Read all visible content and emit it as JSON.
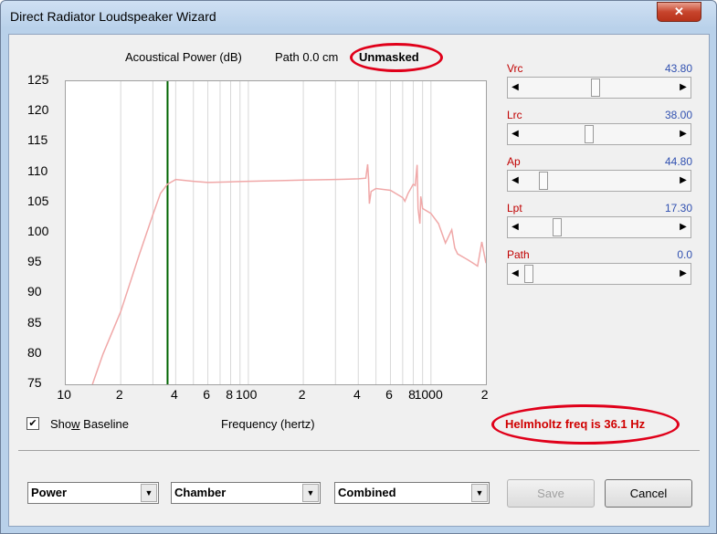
{
  "window": {
    "title": "Direct Radiator Loudspeaker Wizard",
    "close_glyph": "✕"
  },
  "plot_header": {
    "power": "Acoustical Power (dB)",
    "path": "Path 0.0 cm",
    "mask": "Unmasked"
  },
  "chart_data": {
    "type": "line",
    "xlabel": "Frequency (hertz)",
    "ylabel": "",
    "xscale": "log",
    "xlim": [
      10,
      2000
    ],
    "ylim": [
      75,
      125
    ],
    "y_ticks": [
      "125",
      "120",
      "115",
      "110",
      "105",
      "100",
      "95",
      "90",
      "85",
      "80",
      "75"
    ],
    "x_ticks": [
      "10",
      "2",
      "4",
      "6",
      "8",
      "100",
      "2",
      "4",
      "6",
      "8",
      "1000",
      "2"
    ],
    "marker_frequency": 36.1,
    "series": [
      {
        "color": "#f0a8a8",
        "x": [
          14,
          16,
          20,
          25,
          30,
          33,
          36,
          40,
          50,
          60,
          80,
          100,
          150,
          200,
          300,
          400,
          440,
          450,
          455,
          460,
          470,
          500,
          600,
          700,
          720,
          750,
          800,
          820,
          840,
          850,
          870,
          880,
          900,
          1000,
          1100,
          1200,
          1300,
          1350,
          1400,
          1500,
          1600,
          1700,
          1800,
          1900,
          2000
        ],
        "y": [
          75,
          80,
          87,
          96,
          103,
          106.5,
          108,
          108.8,
          108.5,
          108.3,
          108.4,
          108.5,
          108.6,
          108.7,
          108.8,
          108.9,
          109.0,
          111.3,
          109,
          104.8,
          106.8,
          107.3,
          107.0,
          105.8,
          105.2,
          106.5,
          108.0,
          107.8,
          111.2,
          104,
          101.5,
          106,
          104,
          103.2,
          101.5,
          98.3,
          100.5,
          97.5,
          96.5,
          96.0,
          95.5,
          95,
          94.5,
          98.5,
          95
        ]
      }
    ]
  },
  "checkbox": {
    "label_pre": "Sho",
    "label_u": "w",
    "label_post": " Baseline",
    "checked_glyph": "✔"
  },
  "sliders": [
    {
      "name": "Vrc",
      "value": "43.80",
      "pos": 0.47
    },
    {
      "name": "Lrc",
      "value": "38.00",
      "pos": 0.42
    },
    {
      "name": "Ap",
      "value": "44.80",
      "pos": 0.1
    },
    {
      "name": "Lpt",
      "value": "17.30",
      "pos": 0.2
    },
    {
      "name": "Path",
      "value": "0.0",
      "pos": 0.0
    }
  ],
  "slider_arrows": {
    "left": "◀",
    "right": "▶"
  },
  "helmholtz": "Helmholtz freq is 36.1 Hz",
  "combos": [
    {
      "value": "Power"
    },
    {
      "value": "Chamber"
    },
    {
      "value": "Combined"
    }
  ],
  "combo_arrow": "▼",
  "buttons": {
    "save": "Save",
    "cancel": "Cancel"
  },
  "colors": {
    "accent_red": "#e0001a",
    "marker_green": "#006400",
    "curve": "#f0a8a8"
  }
}
